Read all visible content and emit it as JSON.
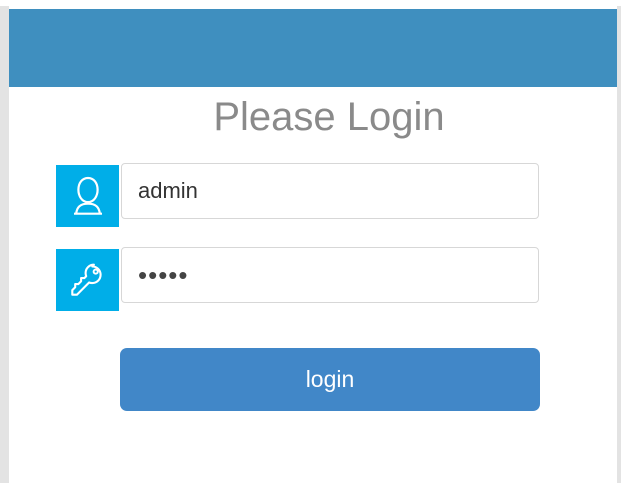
{
  "header": {
    "color": "#3f8fbf"
  },
  "login_form": {
    "title": "Please Login",
    "username": {
      "icon": "user-icon",
      "value": "admin",
      "placeholder": ""
    },
    "password": {
      "icon": "key-icon",
      "value": "•••••",
      "placeholder": ""
    },
    "button_label": "login"
  },
  "colors": {
    "accent": "#4187c8",
    "icon_background": "#00aee8",
    "title_text": "#8a8a8a"
  }
}
